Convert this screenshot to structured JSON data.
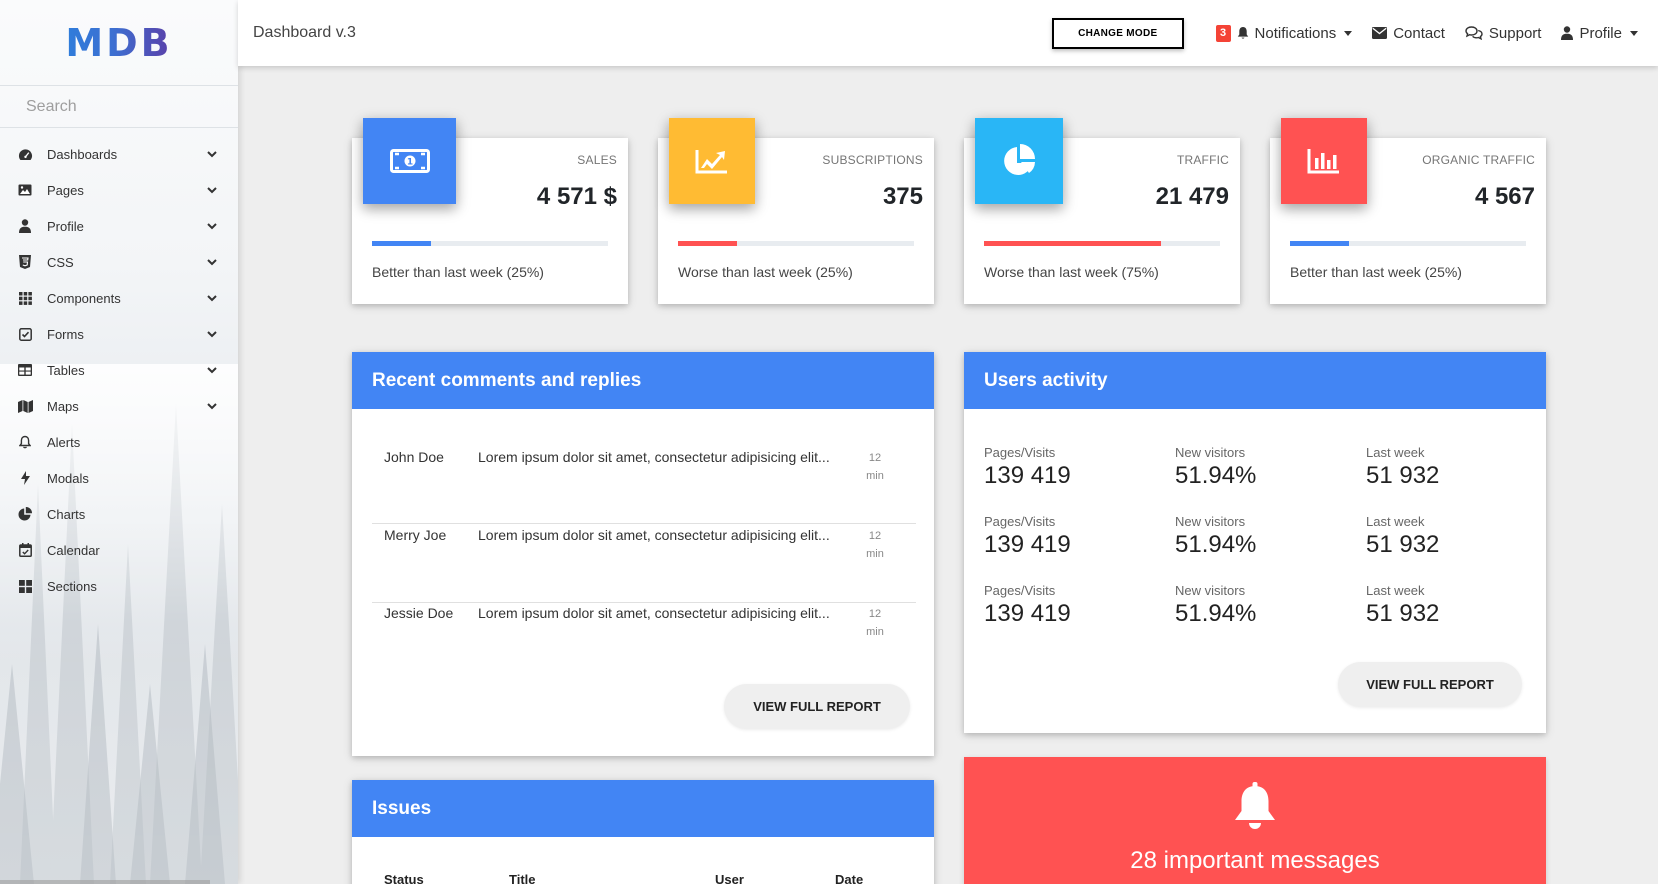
{
  "sidebar": {
    "logo": "MDB",
    "search_placeholder": "Search",
    "items": [
      {
        "label": "Dashboards",
        "icon": "tachometer-icon",
        "has_children": true
      },
      {
        "label": "Pages",
        "icon": "image-icon",
        "has_children": true
      },
      {
        "label": "Profile",
        "icon": "user-icon",
        "has_children": true
      },
      {
        "label": "CSS",
        "icon": "css3-icon",
        "has_children": true
      },
      {
        "label": "Components",
        "icon": "grid-icon",
        "has_children": true
      },
      {
        "label": "Forms",
        "icon": "check-square-icon",
        "has_children": true
      },
      {
        "label": "Tables",
        "icon": "table-icon",
        "has_children": true
      },
      {
        "label": "Maps",
        "icon": "map-icon",
        "has_children": true
      },
      {
        "label": "Alerts",
        "icon": "bell-icon",
        "has_children": false
      },
      {
        "label": "Modals",
        "icon": "bolt-icon",
        "has_children": false
      },
      {
        "label": "Charts",
        "icon": "pie-chart-icon",
        "has_children": false
      },
      {
        "label": "Calendar",
        "icon": "calendar-check-icon",
        "has_children": false
      },
      {
        "label": "Sections",
        "icon": "th-large-icon",
        "has_children": false
      }
    ]
  },
  "topbar": {
    "title": "Dashboard v.3",
    "change_mode": "CHANGE MODE",
    "notifications_count": "3",
    "notifications": "Notifications",
    "contact": "Contact",
    "support": "Support",
    "profile": "Profile"
  },
  "stats": [
    {
      "label": "SALES",
      "value": "4 571 $",
      "progress": 25,
      "color": "#4285f4",
      "bar_color": "#4285f4",
      "note": "Better than last week (25%)",
      "icon": "money-bill-icon"
    },
    {
      "label": "SUBSCRIPTIONS",
      "value": "375",
      "progress": 25,
      "color": "#ffbb33",
      "bar_color": "#ff5252",
      "note": "Worse than last week (25%)",
      "icon": "chart-line-icon"
    },
    {
      "label": "TRAFFIC",
      "value": "21 479",
      "progress": 75,
      "color": "#29b6f6",
      "bar_color": "#ff5252",
      "note": "Worse than last week (75%)",
      "icon": "chart-pie-icon"
    },
    {
      "label": "ORGANIC TRAFFIC",
      "value": "4 567",
      "progress": 25,
      "color": "#ff5252",
      "bar_color": "#4285f4",
      "note": "Better than last week (25%)",
      "icon": "chart-bar-icon"
    }
  ],
  "comments": {
    "title": "Recent comments and replies",
    "rows": [
      {
        "name": "John Doe",
        "text": "Lorem ipsum dolor sit amet, consectetur adipisicing elit...",
        "time_value": "12",
        "time_unit": "min"
      },
      {
        "name": "Merry Joe",
        "text": "Lorem ipsum dolor sit amet, consectetur adipisicing elit...",
        "time_value": "12",
        "time_unit": "min"
      },
      {
        "name": "Jessie Doe",
        "text": "Lorem ipsum dolor sit amet, consectetur adipisicing elit...",
        "time_value": "12",
        "time_unit": "min"
      }
    ],
    "button": "VIEW FULL REPORT"
  },
  "users_activity": {
    "title": "Users activity",
    "rows": [
      [
        {
          "label": "Pages/Visits",
          "value": "139 419"
        },
        {
          "label": "New visitors",
          "value": "51.94%"
        },
        {
          "label": "Last week",
          "value": "51 932"
        }
      ],
      [
        {
          "label": "Pages/Visits",
          "value": "139 419"
        },
        {
          "label": "New visitors",
          "value": "51.94%"
        },
        {
          "label": "Last week",
          "value": "51 932"
        }
      ],
      [
        {
          "label": "Pages/Visits",
          "value": "139 419"
        },
        {
          "label": "New visitors",
          "value": "51.94%"
        },
        {
          "label": "Last week",
          "value": "51 932"
        }
      ]
    ],
    "button": "VIEW FULL REPORT"
  },
  "issues": {
    "title": "Issues",
    "columns": [
      "Status",
      "Title",
      "User",
      "Date"
    ]
  },
  "alert": {
    "icon": "bell-icon",
    "message": "28 important messages"
  }
}
